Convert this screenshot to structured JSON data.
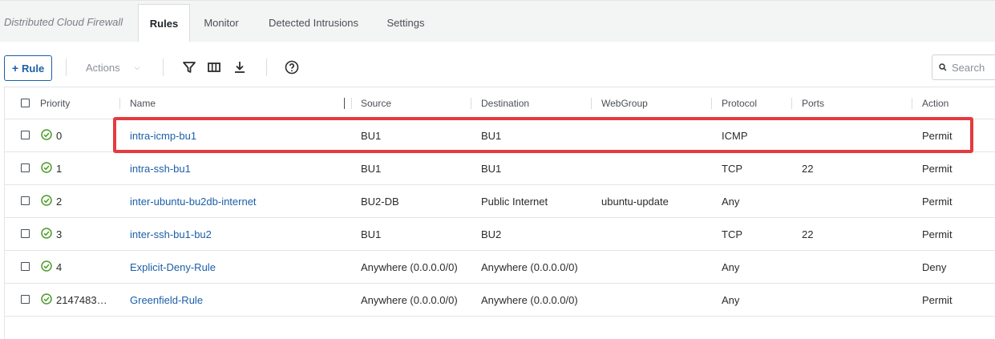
{
  "app_title": "Distributed Cloud Firewall",
  "tabs": [
    {
      "label": "Rules",
      "active": true
    },
    {
      "label": "Monitor",
      "active": false
    },
    {
      "label": "Detected Intrusions",
      "active": false
    },
    {
      "label": "Settings",
      "active": false
    }
  ],
  "toolbar": {
    "add_rule_label": "Rule",
    "actions_label": "Actions",
    "search_placeholder": "Search",
    "icons": [
      "plus-icon",
      "chevron-down-icon",
      "filter-icon",
      "columns-icon",
      "download-icon",
      "help-icon",
      "search-icon"
    ]
  },
  "table": {
    "columns": [
      "Priority",
      "Name",
      "Source",
      "Destination",
      "WebGroup",
      "Protocol",
      "Ports",
      "Action"
    ],
    "rows": [
      {
        "priority": "0",
        "name": "intra-icmp-bu1",
        "source": "BU1",
        "destination": "BU1",
        "webgroup": "",
        "protocol": "ICMP",
        "ports": "",
        "action": "Permit"
      },
      {
        "priority": "1",
        "name": "intra-ssh-bu1",
        "source": "BU1",
        "destination": "BU1",
        "webgroup": "",
        "protocol": "TCP",
        "ports": "22",
        "action": "Permit"
      },
      {
        "priority": "2",
        "name": "inter-ubuntu-bu2db-internet",
        "source": "BU2-DB",
        "destination": "Public Internet",
        "webgroup": "ubuntu-update",
        "protocol": "Any",
        "ports": "",
        "action": "Permit"
      },
      {
        "priority": "3",
        "name": "inter-ssh-bu1-bu2",
        "source": "BU1",
        "destination": "BU2",
        "webgroup": "",
        "protocol": "TCP",
        "ports": "22",
        "action": "Permit"
      },
      {
        "priority": "4",
        "name": "Explicit-Deny-Rule",
        "source": "Anywhere (0.0.0.0/0)",
        "destination": "Anywhere (0.0.0.0/0)",
        "webgroup": "",
        "protocol": "Any",
        "ports": "",
        "action": "Deny"
      },
      {
        "priority": "2147483…",
        "name": "Greenfield-Rule",
        "source": "Anywhere (0.0.0.0/0)",
        "destination": "Anywhere (0.0.0.0/0)",
        "webgroup": "",
        "protocol": "Any",
        "ports": "",
        "action": "Permit"
      }
    ]
  },
  "colors": {
    "accent": "#1b5fa8",
    "status_ok": "#4c9a2a",
    "highlight": "#e53a3f"
  }
}
